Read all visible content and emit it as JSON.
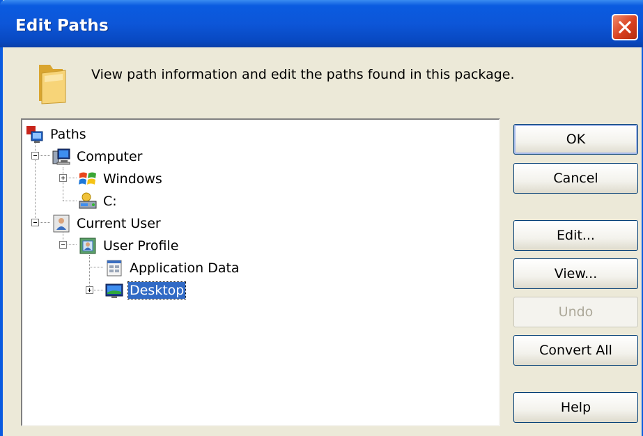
{
  "window": {
    "title": "Edit Paths"
  },
  "header": {
    "icon": "folder-icon",
    "description": "View path information and edit the paths found in this package."
  },
  "tree": {
    "nodes": [
      {
        "label": "Paths",
        "icon": "paths-icon",
        "expander": "none"
      },
      {
        "label": "Computer",
        "icon": "computer-icon",
        "expander": "expanded"
      },
      {
        "label": "Windows",
        "icon": "windows-icon",
        "expander": "collapsed"
      },
      {
        "label": "C:",
        "icon": "drive-icon",
        "expander": "none"
      },
      {
        "label": "Current User",
        "icon": "user-icon",
        "expander": "expanded"
      },
      {
        "label": "User Profile",
        "icon": "user-profile-icon",
        "expander": "expanded"
      },
      {
        "label": "Application Data",
        "icon": "application-data-icon",
        "expander": "none"
      },
      {
        "label": "Desktop",
        "icon": "desktop-icon",
        "expander": "collapsed",
        "selected": true
      }
    ]
  },
  "buttons": {
    "ok": "OK",
    "cancel": "Cancel",
    "edit": "Edit...",
    "view": "View...",
    "undo": "Undo",
    "convert_all": "Convert All",
    "help": "Help"
  },
  "colors": {
    "titlebar": "#0a5be0",
    "dialog": "#ece9d8",
    "selection": "#316ac5",
    "close_button": "#d8401f"
  }
}
